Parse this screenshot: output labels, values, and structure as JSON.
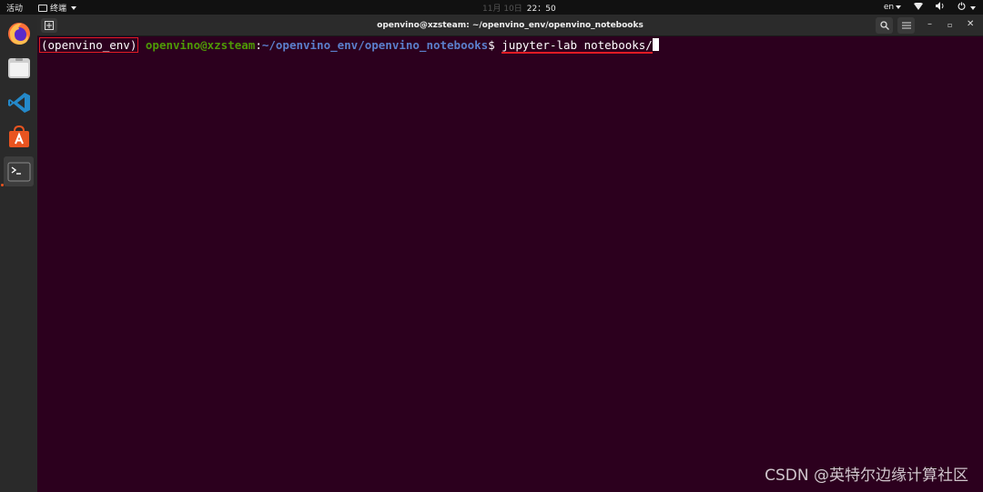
{
  "topbar": {
    "activities": "活动",
    "app_menu": "终端",
    "clock_date": "11月 10日",
    "clock_time": "22：50",
    "lang": "en"
  },
  "dock": {
    "items": [
      {
        "icon": "firefox-icon"
      },
      {
        "icon": "files-icon"
      },
      {
        "icon": "vscode-icon"
      },
      {
        "icon": "software-store-icon"
      },
      {
        "icon": "terminal-icon",
        "active": true
      }
    ],
    "accent": "#e95420"
  },
  "window": {
    "title": "openvino@xzsteam: ~/openvino_env/openvino_notebooks"
  },
  "terminal": {
    "venv": "(openvino_env)",
    "userhost": "openvino@xzsteam",
    "sep": ":",
    "path": "~/openvino_env/openvino_notebooks",
    "prompt_char": "$ ",
    "command": "jupyter-lab notebooks/",
    "colors": {
      "background": "#2c001e",
      "userhost": "#4e9a06",
      "path": "#5b7fcb",
      "highlight": "#e01b24"
    }
  },
  "watermark": "CSDN @英特尔边缘计算社区"
}
